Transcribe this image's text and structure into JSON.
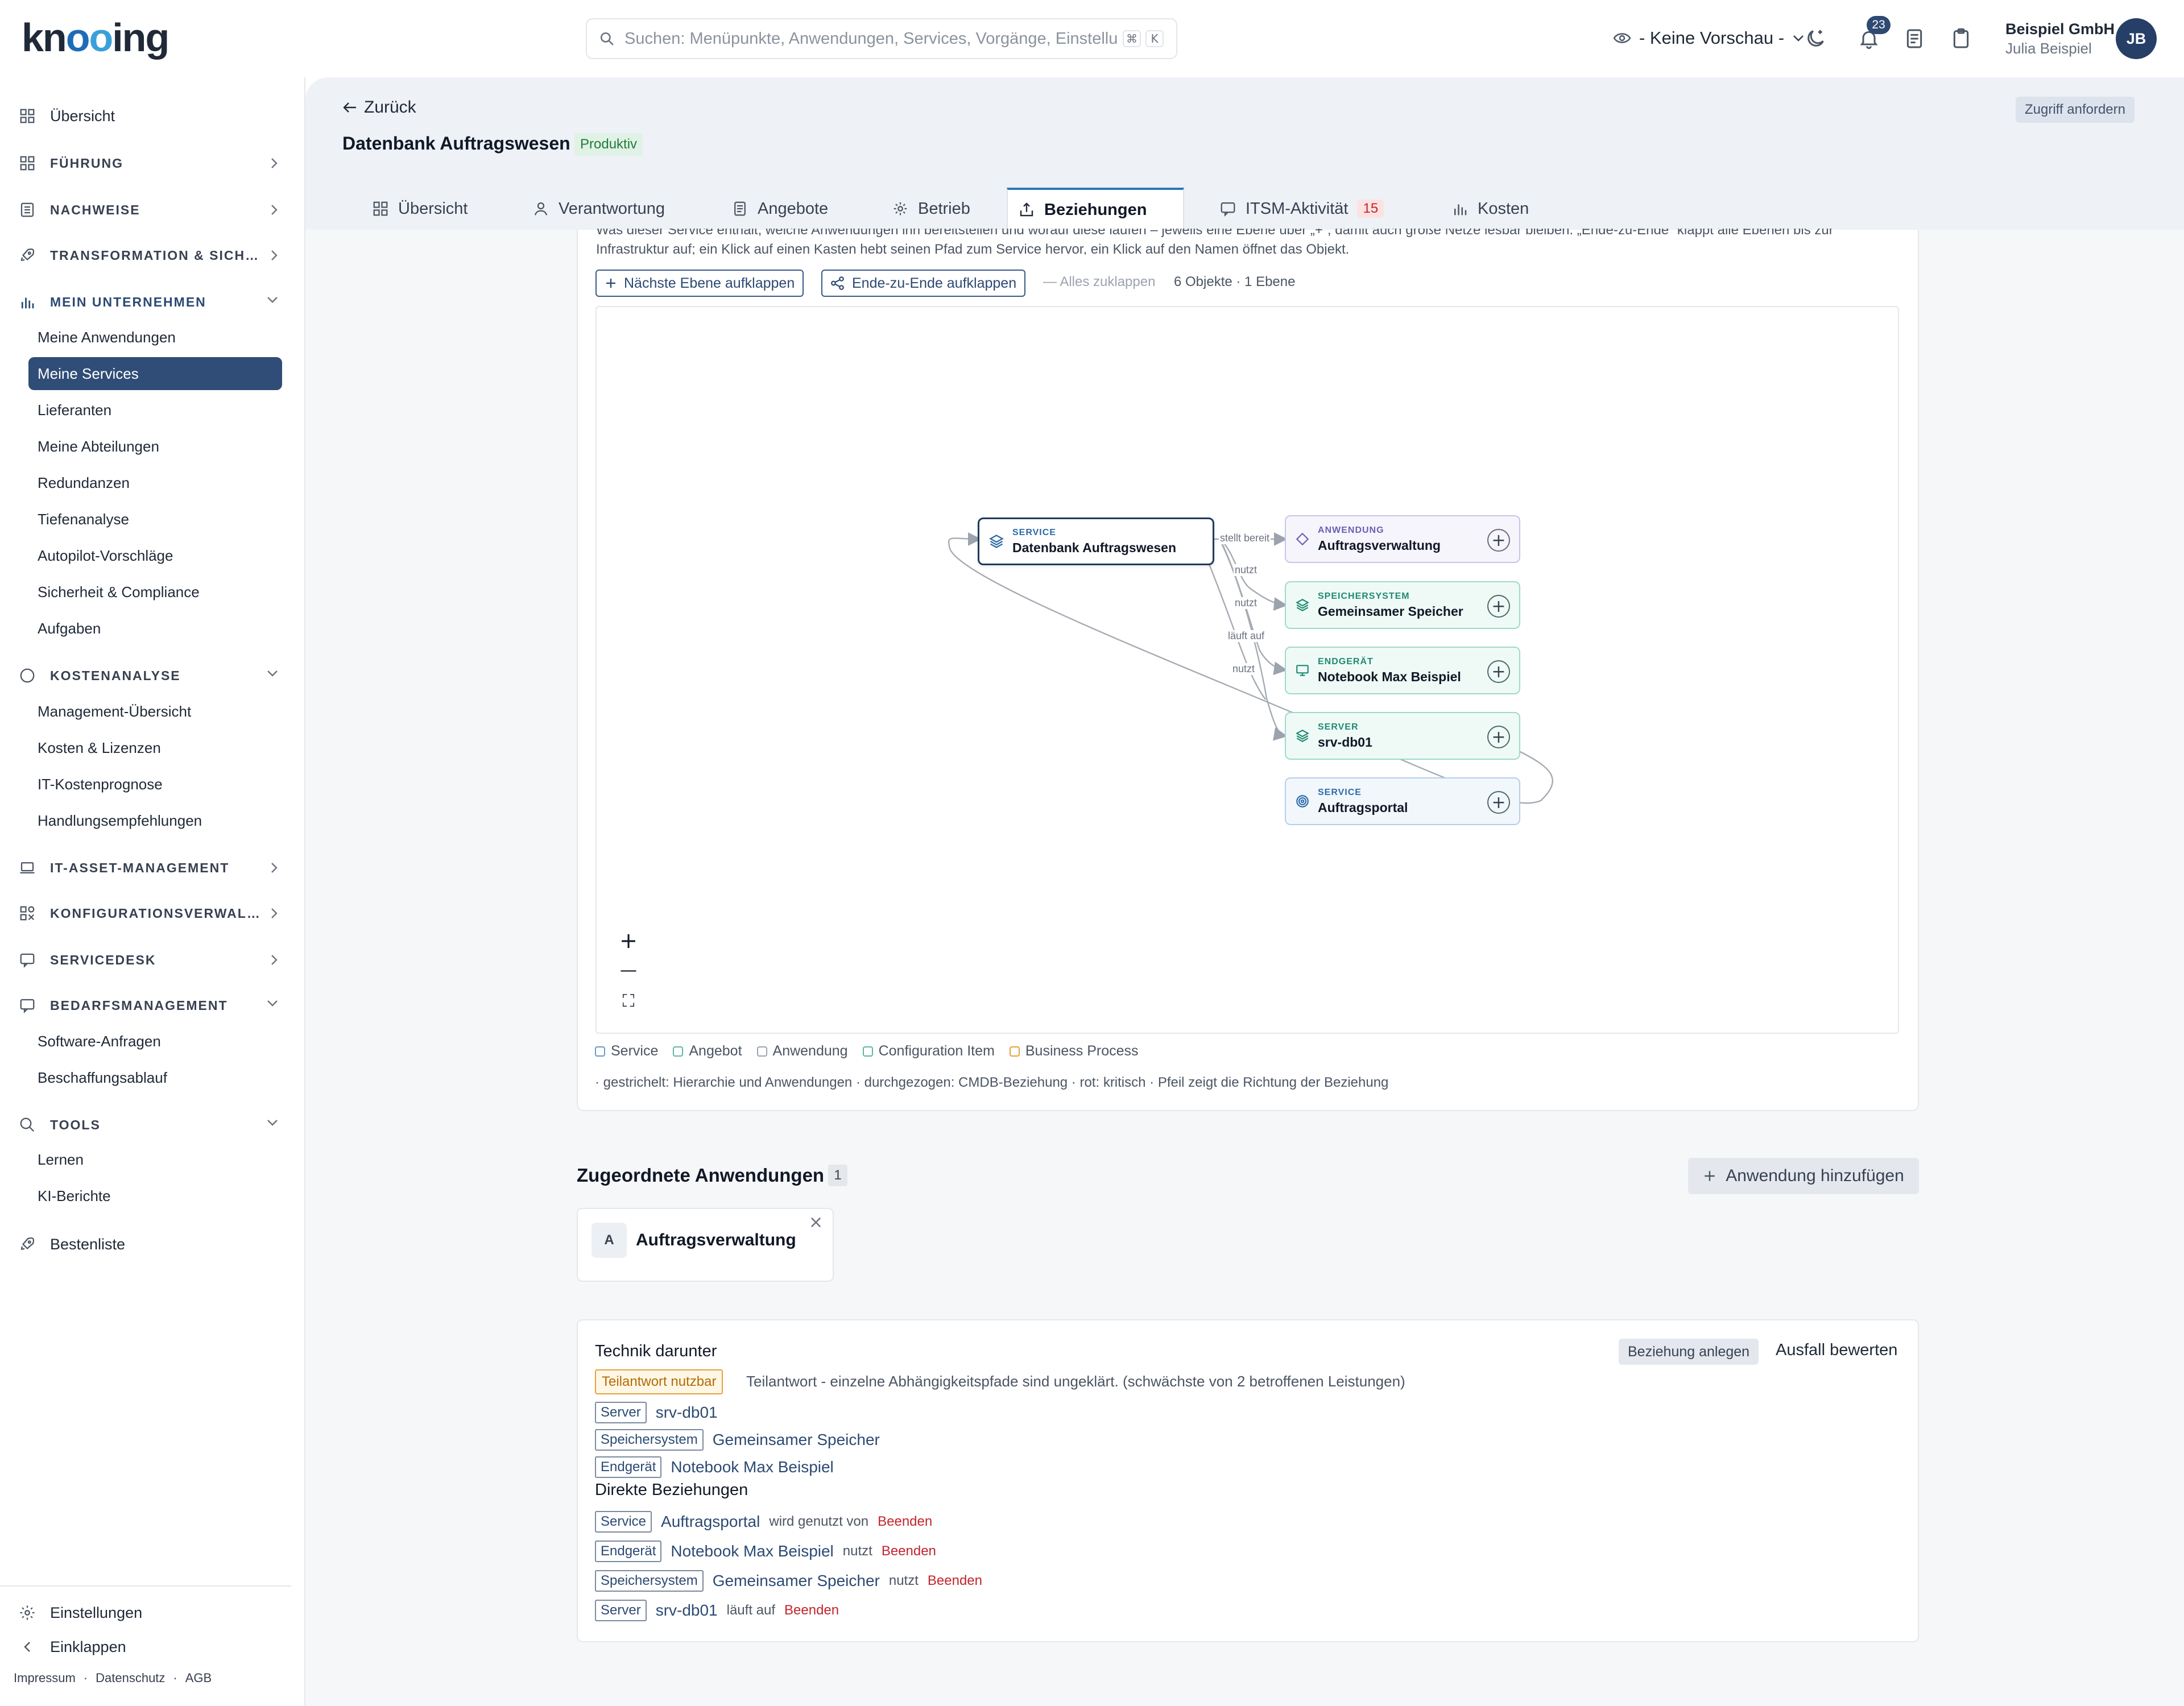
{
  "app": {
    "logo": "knooing",
    "search_placeholder": "Suchen: Menüpunkte, Anwendungen, Services, Vorgänge, Einstellungen",
    "search_shortcut": [
      "⌘",
      "K"
    ],
    "preview_label": "- Keine Vorschau -",
    "notification_count": "23",
    "company": "Beispiel GmbH",
    "user": "Julia Beispiel",
    "avatar": "JB"
  },
  "sidebar": {
    "overview": "Übersicht",
    "groups": {
      "fuehrung": "FÜHRUNG",
      "nachweise": "NACHWEISE",
      "transformation": "TRANSFORMATION & SICH…",
      "unternehmen": "MEIN UNTERNEHMEN",
      "kosten": "KOSTENANALYSE",
      "itam": "IT-ASSET-MANAGEMENT",
      "konfig": "KONFIGURATIONSVERWAL…",
      "servicedesk": "SERVICEDESK",
      "bedarf": "BEDARFSMANAGEMENT",
      "tools": "TOOLS"
    },
    "unternehmen_items": [
      "Meine Anwendungen",
      "Meine Services",
      "Lieferanten",
      "Meine Abteilungen",
      "Redundanzen",
      "Tiefenanalyse",
      "Autopilot-Vorschläge",
      "Sicherheit & Compliance",
      "Aufgaben"
    ],
    "kosten_items": [
      "Management-Übersicht",
      "Kosten & Lizenzen",
      "IT-Kostenprognose",
      "Handlungsempfehlungen"
    ],
    "bedarf_items": [
      "Software-Anfragen",
      "Beschaffungsablauf"
    ],
    "tools_items": [
      "Lernen",
      "KI-Berichte"
    ],
    "bestenliste": "Bestenliste",
    "settings": "Einstellungen",
    "collapse": "Einklappen",
    "footer": [
      "Impressum",
      "·",
      "Datenschutz",
      "·",
      "AGB"
    ]
  },
  "header": {
    "back": "Zurück",
    "title": "Datenbank Auftragswesen",
    "status": "Produktiv",
    "access_button": "Zugriff anfordern",
    "tabs": [
      "Übersicht",
      "Verantwortung",
      "Angebote",
      "Betrieb",
      "Beziehungen",
      "ITSM-Aktivität",
      "Kosten"
    ],
    "itsm_count": "15"
  },
  "relations": {
    "description": "Was dieser Service enthält, welche Anwendungen ihn bereitstellen und worauf diese laufen – jeweils eine Ebene über „+“, damit auch große Netze lesbar bleiben. „Ende-zu-Ende“ klappt alle Ebenen bis zur Infrastruktur auf; ein Klick auf einen Kasten hebt seinen Pfad zum Service hervor, ein Klick auf den Namen öffnet das Objekt.",
    "expand_next": "Nächste Ebene aufklappen",
    "expand_all": "Ende-zu-Ende aufklappen",
    "collapse_all": "— Alles zuklappen",
    "object_count": "6 Objekte · 1 Ebene",
    "nodes": {
      "root": {
        "type": "SERVICE",
        "name": "Datenbank Auftragswesen"
      },
      "app": {
        "type": "ANWENDUNG",
        "name": "Auftragsverwaltung"
      },
      "storage": {
        "type": "SPEICHERSYSTEM",
        "name": "Gemeinsamer Speicher"
      },
      "device": {
        "type": "ENDGERÄT",
        "name": "Notebook Max Beispiel"
      },
      "server": {
        "type": "SERVER",
        "name": "srv-db01"
      },
      "portal": {
        "type": "SERVICE",
        "name": "Auftragsportal"
      }
    },
    "edge_labels": [
      "stellt bereit",
      "nutzt",
      "nutzt",
      "läuft auf",
      "nutzt"
    ],
    "zoom": [
      "+",
      "—",
      "⛶"
    ],
    "legend": [
      "Service",
      "Angebot",
      "Anwendung",
      "Configuration Item",
      "Business Process"
    ],
    "legend_colors": [
      "#6a97c9",
      "#5fb4a8",
      "#9aa3ae",
      "#5fb4a8",
      "#e4a13a"
    ],
    "legend_note": "· gestrichelt: Hierarchie und Anwendungen · durchgezogen: CMDB-Beziehung · rot: kritisch · Pfeil zeigt die Richtung der Beziehung"
  },
  "apps": {
    "title": "Zugeordnete Anwendungen",
    "count": "1",
    "add_button": "Anwendung hinzufügen",
    "items": [
      {
        "letter": "A",
        "name": "Auftragsverwaltung"
      }
    ]
  },
  "tech": {
    "title": "Technik darunter",
    "add_relation": "Beziehung anlegen",
    "assess": "Ausfall bewerten",
    "partial_badge": "Teilantwort nutzbar",
    "partial_text": "Teilantwort - einzelne Abhängigkeitspfade sind ungeklärt. (schwächste von 2 betroffenen Leistungen)",
    "below": [
      {
        "tag": "Server",
        "name": "srv-db01"
      },
      {
        "tag": "Speichersystem",
        "name": "Gemeinsamer Speicher"
      },
      {
        "tag": "Endgerät",
        "name": "Notebook Max Beispiel"
      }
    ],
    "direct_title": "Direkte Beziehungen",
    "direct": [
      {
        "tag": "Service",
        "name": "Auftragsportal",
        "rel": "wird genutzt von",
        "action": "Beenden"
      },
      {
        "tag": "Endgerät",
        "name": "Notebook Max Beispiel",
        "rel": "nutzt",
        "action": "Beenden"
      },
      {
        "tag": "Speichersystem",
        "name": "Gemeinsamer Speicher",
        "rel": "nutzt",
        "action": "Beenden"
      },
      {
        "tag": "Server",
        "name": "srv-db01",
        "rel": "läuft auf",
        "action": "Beenden"
      }
    ]
  }
}
